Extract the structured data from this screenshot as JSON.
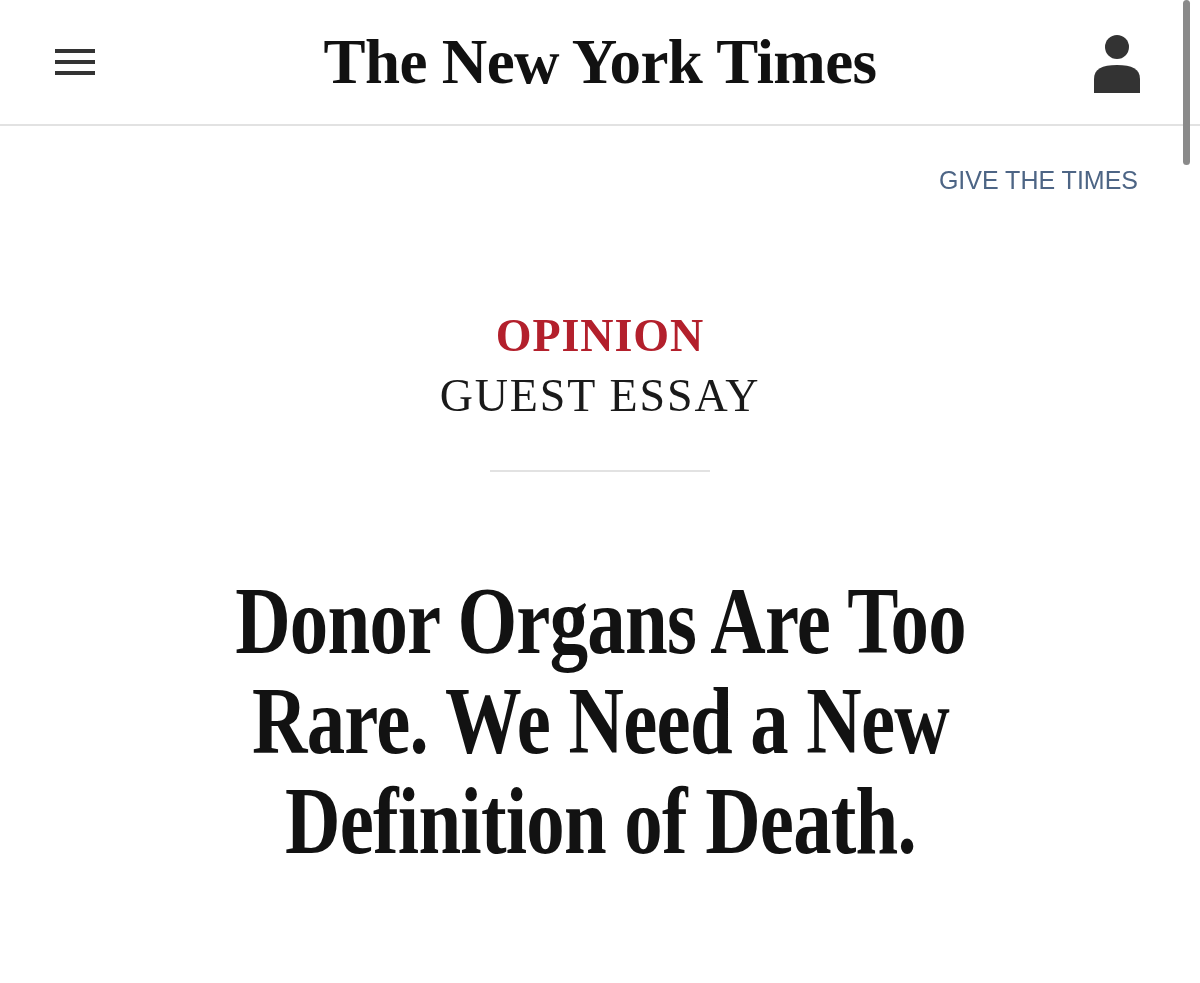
{
  "header": {
    "logo": "The New York Times"
  },
  "gift_link": "GIVE THE TIMES",
  "article": {
    "section": "OPINION",
    "label": "GUEST ESSAY",
    "headline": "Donor Organs Are Too Rare. We Need a New Definition of Death."
  }
}
